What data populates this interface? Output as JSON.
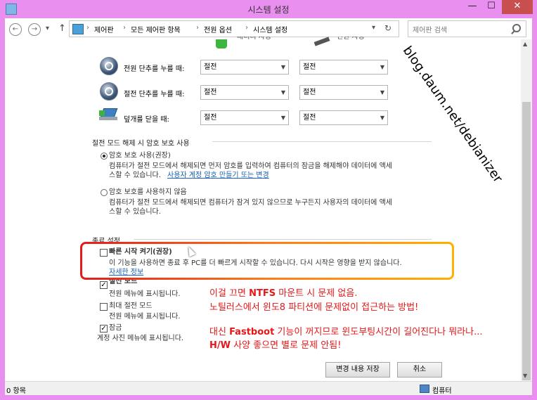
{
  "window": {
    "title": "시스템 설정",
    "minimize": "—",
    "maximize": "☐",
    "close": "✕"
  },
  "nav": {
    "back": "←",
    "forward": "→",
    "dropdown": "▾",
    "up": "↑",
    "breadcrumb": [
      "제어판",
      "모든 제어판 항목",
      "전원 옵션",
      "시스템 설정"
    ],
    "breadcrumb_sep": "›",
    "refresh": "↻",
    "search_placeholder": "제어판 검색",
    "search_icon": "search-icon"
  },
  "power_table": {
    "header_cut_1": "배터리 사용",
    "header_cut_2": "전원 사용",
    "rows": [
      {
        "label": "전원 단추를 누를 때:",
        "battery": "절전",
        "plugged": "절전",
        "icon": "power-button-icon"
      },
      {
        "label": "절전 단추를 누를 때:",
        "battery": "절전",
        "plugged": "절전",
        "icon": "sleep-button-icon"
      },
      {
        "label": "덮개를 닫을 때:",
        "battery": "절전",
        "plugged": "절전",
        "icon": "lid-close-icon"
      }
    ]
  },
  "password": {
    "section_title": "절전 모드 해제 시 암호 보호 사용",
    "opt1_label": "암호 보호 사용(권장)",
    "opt1_desc_1": "컴퓨터가 절전 모드에서 해제되면 먼저 암호를 입력하여 컴퓨터의 잠금을 해제해야 데이터에 액세",
    "opt1_desc_2": "스할 수 있습니다.",
    "opt1_link": "사용자 계정 암호 만들기 또는 변경",
    "opt2_label": "암호 보호를 사용하지 않음",
    "opt2_desc_1": "컴퓨터가 절전 모드에서 해제되면 컴퓨터가 잠겨 있지 않으므로 누구든지 사용자의 데이터에 액세",
    "opt2_desc_2": "스할 수 있습니다.",
    "selected": "opt1"
  },
  "shutdown": {
    "section_title": "종료 설정",
    "fast_startup_label": "빠른 시작 켜기(권장)",
    "fast_startup_desc": "이 기능을 사용하면 종료 후 PC를 더 빠르게 시작할 수 있습니다. 다시 시작은 영향을 받지 않습니다.",
    "fast_startup_link": "자세한 정보",
    "fast_startup_checked": false,
    "sleep_label": "절전 모드",
    "sleep_desc": "전원 메뉴에 표시됩니다.",
    "sleep_checked": true,
    "hibernate_label": "최대 절전 모드",
    "hibernate_desc": "전원 메뉴에 표시됩니다.",
    "hibernate_checked": false,
    "lock_label": "잠금",
    "lock_desc": "계정 사진 메뉴에 표시됩니다.",
    "lock_checked": true
  },
  "annotation": {
    "line1_a": "이걸 끄면 ",
    "line1_b": "NTFS",
    "line1_c": " 마운트 시 문제 없음.",
    "line2": "노틸러스에서 윈도8 파티션에 문제없이 접근하는 방법!",
    "line3_a": "대신 ",
    "line3_b": "Fastboot",
    "line3_c": " 기능이 꺼지므로 윈도부팅시간이 길어진다나 뭐라나...",
    "line4_a": "H/W",
    "line4_b": " 사양 좋으면 별로 문제 안됨!",
    "color": "#e81616"
  },
  "watermark": "blog.daum.net/debianizer",
  "buttons": {
    "save": "변경 내용 저장",
    "cancel": "취소"
  },
  "status": {
    "items": "0 항목",
    "computer": "컴퓨터"
  }
}
